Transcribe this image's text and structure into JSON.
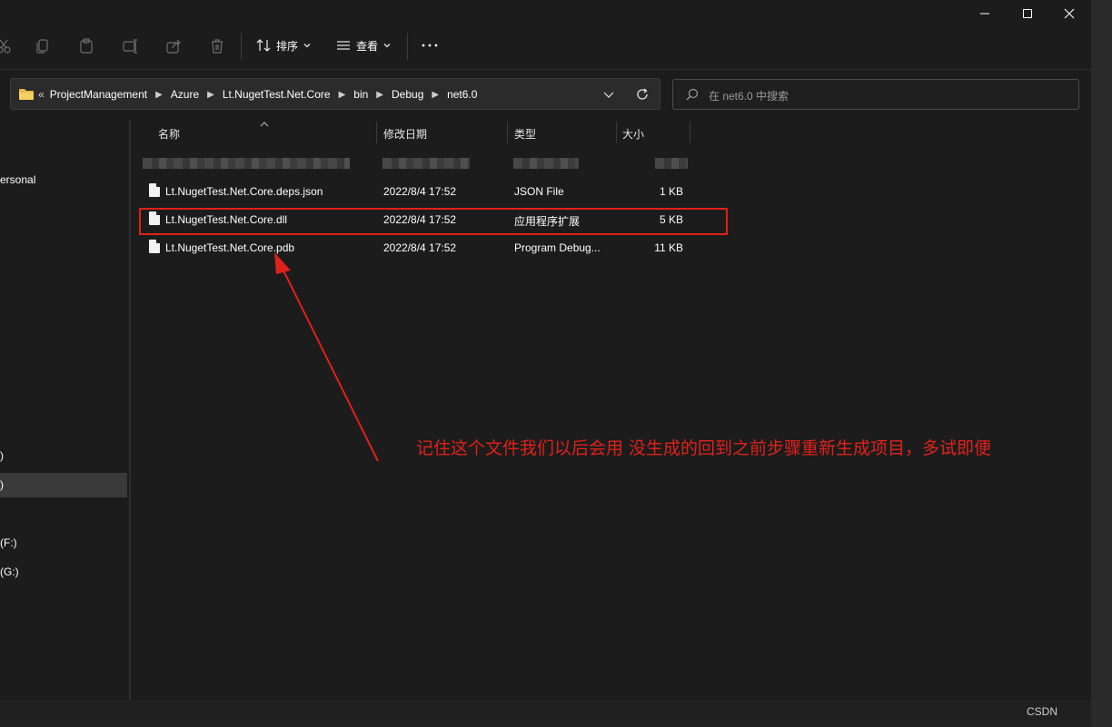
{
  "window": {
    "controls": [
      "minimize-icon",
      "maximize-icon",
      "close-icon"
    ]
  },
  "commandbar": {
    "sort_label": "排序",
    "view_label": "查看",
    "icons": [
      "cut-icon",
      "copy-icon",
      "paste-icon",
      "rename-icon",
      "share-icon",
      "delete-icon",
      "more-icon"
    ]
  },
  "address": {
    "prefix": "«",
    "crumbs": [
      "ProjectManagement",
      "Azure",
      "Lt.NugetTest.Net.Core",
      "bin",
      "Debug",
      "net6.0"
    ]
  },
  "search": {
    "placeholder": "在 net6.0 中搜索"
  },
  "navpane": {
    "items": [
      "ersonal",
      ")",
      ")",
      "(F:)",
      "(G:)"
    ]
  },
  "columns": {
    "name": "名称",
    "date": "修改日期",
    "type": "类型",
    "size": "大小"
  },
  "files": [
    {
      "name": "Lt.NugetTest.Net.Core.deps.json",
      "date": "2022/8/4 17:52",
      "type": "JSON File",
      "size": "1 KB"
    },
    {
      "name": "Lt.NugetTest.Net.Core.dll",
      "date": "2022/8/4 17:52",
      "type": "应用程序扩展",
      "size": "5 KB"
    },
    {
      "name": "Lt.NugetTest.Net.Core.pdb",
      "date": "2022/8/4 17:52",
      "type": "Program Debug...",
      "size": "11 KB"
    }
  ],
  "annotation": {
    "text": "记住这个文件我们以后会用 没生成的回到之前步骤重新生成项目，多试即便",
    "color": "#e0211a"
  },
  "watermark": "CSDN"
}
